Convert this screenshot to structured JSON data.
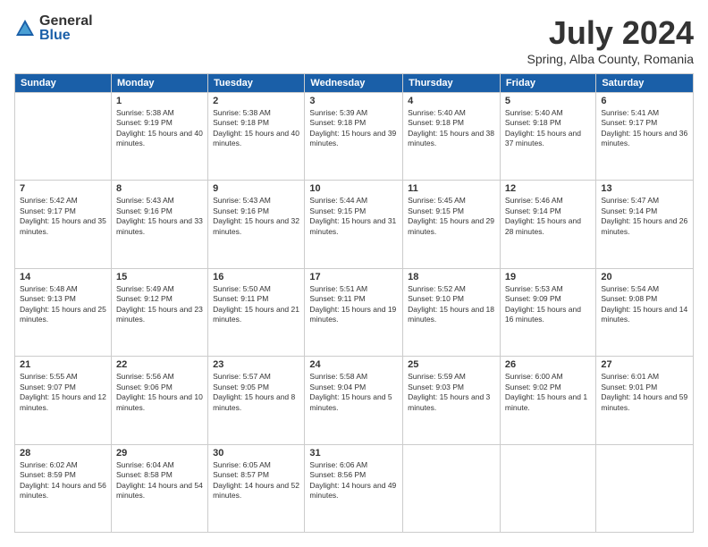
{
  "header": {
    "logo_general": "General",
    "logo_blue": "Blue",
    "month_title": "July 2024",
    "location": "Spring, Alba County, Romania"
  },
  "weekdays": [
    "Sunday",
    "Monday",
    "Tuesday",
    "Wednesday",
    "Thursday",
    "Friday",
    "Saturday"
  ],
  "weeks": [
    [
      {
        "day": "",
        "sunrise": "",
        "sunset": "",
        "daylight": ""
      },
      {
        "day": "1",
        "sunrise": "Sunrise: 5:38 AM",
        "sunset": "Sunset: 9:19 PM",
        "daylight": "Daylight: 15 hours and 40 minutes."
      },
      {
        "day": "2",
        "sunrise": "Sunrise: 5:38 AM",
        "sunset": "Sunset: 9:18 PM",
        "daylight": "Daylight: 15 hours and 40 minutes."
      },
      {
        "day": "3",
        "sunrise": "Sunrise: 5:39 AM",
        "sunset": "Sunset: 9:18 PM",
        "daylight": "Daylight: 15 hours and 39 minutes."
      },
      {
        "day": "4",
        "sunrise": "Sunrise: 5:40 AM",
        "sunset": "Sunset: 9:18 PM",
        "daylight": "Daylight: 15 hours and 38 minutes."
      },
      {
        "day": "5",
        "sunrise": "Sunrise: 5:40 AM",
        "sunset": "Sunset: 9:18 PM",
        "daylight": "Daylight: 15 hours and 37 minutes."
      },
      {
        "day": "6",
        "sunrise": "Sunrise: 5:41 AM",
        "sunset": "Sunset: 9:17 PM",
        "daylight": "Daylight: 15 hours and 36 minutes."
      }
    ],
    [
      {
        "day": "7",
        "sunrise": "Sunrise: 5:42 AM",
        "sunset": "Sunset: 9:17 PM",
        "daylight": "Daylight: 15 hours and 35 minutes."
      },
      {
        "day": "8",
        "sunrise": "Sunrise: 5:43 AM",
        "sunset": "Sunset: 9:16 PM",
        "daylight": "Daylight: 15 hours and 33 minutes."
      },
      {
        "day": "9",
        "sunrise": "Sunrise: 5:43 AM",
        "sunset": "Sunset: 9:16 PM",
        "daylight": "Daylight: 15 hours and 32 minutes."
      },
      {
        "day": "10",
        "sunrise": "Sunrise: 5:44 AM",
        "sunset": "Sunset: 9:15 PM",
        "daylight": "Daylight: 15 hours and 31 minutes."
      },
      {
        "day": "11",
        "sunrise": "Sunrise: 5:45 AM",
        "sunset": "Sunset: 9:15 PM",
        "daylight": "Daylight: 15 hours and 29 minutes."
      },
      {
        "day": "12",
        "sunrise": "Sunrise: 5:46 AM",
        "sunset": "Sunset: 9:14 PM",
        "daylight": "Daylight: 15 hours and 28 minutes."
      },
      {
        "day": "13",
        "sunrise": "Sunrise: 5:47 AM",
        "sunset": "Sunset: 9:14 PM",
        "daylight": "Daylight: 15 hours and 26 minutes."
      }
    ],
    [
      {
        "day": "14",
        "sunrise": "Sunrise: 5:48 AM",
        "sunset": "Sunset: 9:13 PM",
        "daylight": "Daylight: 15 hours and 25 minutes."
      },
      {
        "day": "15",
        "sunrise": "Sunrise: 5:49 AM",
        "sunset": "Sunset: 9:12 PM",
        "daylight": "Daylight: 15 hours and 23 minutes."
      },
      {
        "day": "16",
        "sunrise": "Sunrise: 5:50 AM",
        "sunset": "Sunset: 9:11 PM",
        "daylight": "Daylight: 15 hours and 21 minutes."
      },
      {
        "day": "17",
        "sunrise": "Sunrise: 5:51 AM",
        "sunset": "Sunset: 9:11 PM",
        "daylight": "Daylight: 15 hours and 19 minutes."
      },
      {
        "day": "18",
        "sunrise": "Sunrise: 5:52 AM",
        "sunset": "Sunset: 9:10 PM",
        "daylight": "Daylight: 15 hours and 18 minutes."
      },
      {
        "day": "19",
        "sunrise": "Sunrise: 5:53 AM",
        "sunset": "Sunset: 9:09 PM",
        "daylight": "Daylight: 15 hours and 16 minutes."
      },
      {
        "day": "20",
        "sunrise": "Sunrise: 5:54 AM",
        "sunset": "Sunset: 9:08 PM",
        "daylight": "Daylight: 15 hours and 14 minutes."
      }
    ],
    [
      {
        "day": "21",
        "sunrise": "Sunrise: 5:55 AM",
        "sunset": "Sunset: 9:07 PM",
        "daylight": "Daylight: 15 hours and 12 minutes."
      },
      {
        "day": "22",
        "sunrise": "Sunrise: 5:56 AM",
        "sunset": "Sunset: 9:06 PM",
        "daylight": "Daylight: 15 hours and 10 minutes."
      },
      {
        "day": "23",
        "sunrise": "Sunrise: 5:57 AM",
        "sunset": "Sunset: 9:05 PM",
        "daylight": "Daylight: 15 hours and 8 minutes."
      },
      {
        "day": "24",
        "sunrise": "Sunrise: 5:58 AM",
        "sunset": "Sunset: 9:04 PM",
        "daylight": "Daylight: 15 hours and 5 minutes."
      },
      {
        "day": "25",
        "sunrise": "Sunrise: 5:59 AM",
        "sunset": "Sunset: 9:03 PM",
        "daylight": "Daylight: 15 hours and 3 minutes."
      },
      {
        "day": "26",
        "sunrise": "Sunrise: 6:00 AM",
        "sunset": "Sunset: 9:02 PM",
        "daylight": "Daylight: 15 hours and 1 minute."
      },
      {
        "day": "27",
        "sunrise": "Sunrise: 6:01 AM",
        "sunset": "Sunset: 9:01 PM",
        "daylight": "Daylight: 14 hours and 59 minutes."
      }
    ],
    [
      {
        "day": "28",
        "sunrise": "Sunrise: 6:02 AM",
        "sunset": "Sunset: 8:59 PM",
        "daylight": "Daylight: 14 hours and 56 minutes."
      },
      {
        "day": "29",
        "sunrise": "Sunrise: 6:04 AM",
        "sunset": "Sunset: 8:58 PM",
        "daylight": "Daylight: 14 hours and 54 minutes."
      },
      {
        "day": "30",
        "sunrise": "Sunrise: 6:05 AM",
        "sunset": "Sunset: 8:57 PM",
        "daylight": "Daylight: 14 hours and 52 minutes."
      },
      {
        "day": "31",
        "sunrise": "Sunrise: 6:06 AM",
        "sunset": "Sunset: 8:56 PM",
        "daylight": "Daylight: 14 hours and 49 minutes."
      },
      {
        "day": "",
        "sunrise": "",
        "sunset": "",
        "daylight": ""
      },
      {
        "day": "",
        "sunrise": "",
        "sunset": "",
        "daylight": ""
      },
      {
        "day": "",
        "sunrise": "",
        "sunset": "",
        "daylight": ""
      }
    ]
  ]
}
